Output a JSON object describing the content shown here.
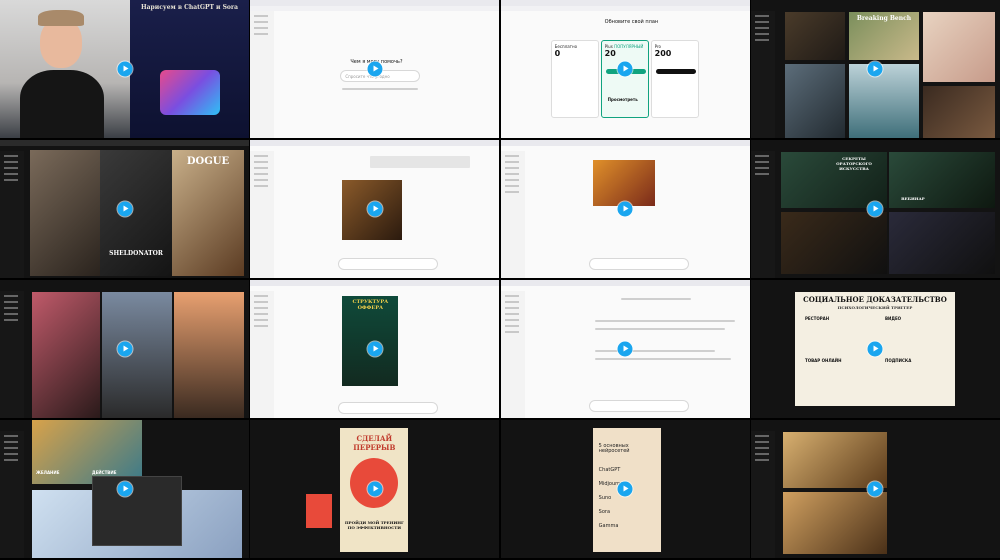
{
  "video_frames": [
    {
      "overlay": {
        "title": "Нарисуем в ChatGPT и Sora"
      }
    },
    {
      "chat": {
        "heading": "Чем я могу помочь?",
        "placeholder": "Спросите что угодно"
      }
    },
    {
      "pricing": {
        "heading": "Обновите свой план",
        "plans": [
          {
            "name": "Бесплатно",
            "price": "0"
          },
          {
            "name": "Plus",
            "badge": "ПОПУЛЯРНЫЙ",
            "price": "20"
          },
          {
            "name": "Pro",
            "price": "200"
          }
        ],
        "plus_button_label": "Просмотреть"
      }
    },
    {
      "gallery": {
        "caption": "Breaking Bench"
      }
    },
    {
      "gallery": {
        "captions": [
          "SHELDONATOR",
          "DOGUE"
        ]
      }
    },
    {
      "chat": {
        "topic": "Художник рисует в мастерской"
      }
    },
    {
      "chat": {
        "topic": "Сказочный домик"
      }
    },
    {
      "gallery": {
        "captions": [
          "СЕКРЕТЫ ОРАТОРСКОГО ИСКУССТВА",
          "ВЕБИНАР"
        ]
      }
    },
    {
      "gallery": {
        "captions": []
      }
    },
    {
      "chat": {
        "poster_title": "СТРУКТУРА ОФФЕРА"
      }
    },
    {
      "chat": {
        "topic": "Ответ ассистента"
      }
    },
    {
      "poster": {
        "title": "СОЦИАЛЬНОЕ ДОКАЗАТЕЛЬСТВО",
        "subtitle": "ПСИХОЛОГИЧЕСКИЙ ТРИГГЕР",
        "cells": [
          "РЕСТОРАН",
          "ВИДЕО",
          "ТОВАР ОНЛАЙН",
          "ПОДПИСКА"
        ]
      }
    },
    {
      "comic": {
        "labels": [
          "ЖЕЛАНИЕ",
          "ДЕЙСТВИЕ"
        ]
      }
    },
    {
      "poster": {
        "title": "СДЕЛАЙ ПЕРЕРЫВ",
        "subtitle": "ПРОЙДИ МОЙ ТРЕНИНГ ПО ЭФФЕКТИВНОСТИ"
      }
    },
    {
      "notebook": {
        "title": "5 основных нейросетей",
        "items": [
          "ChatGPT",
          "Midjourney",
          "Suno",
          "Sora",
          "Gamma"
        ]
      }
    },
    {
      "gallery": {
        "captions": []
      }
    }
  ],
  "colors": {
    "play": "#1aa6ef",
    "accent_green": "#10a37f"
  }
}
